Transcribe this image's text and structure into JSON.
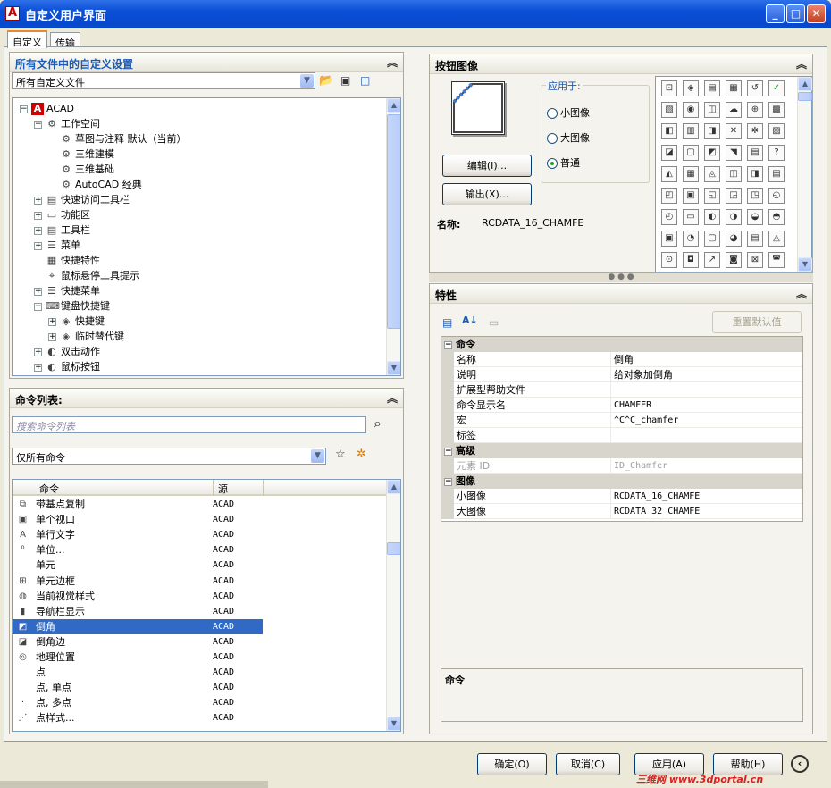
{
  "window": {
    "title": "自定义用户界面",
    "logo_letter": "A"
  },
  "tabs": [
    {
      "label": "自定义"
    },
    {
      "label": "传输"
    }
  ],
  "customizations": {
    "title": "所有文件中的自定义设置",
    "file_select": "所有自定义文件",
    "tree": [
      {
        "label": "ACAD",
        "icon": "acad-logo-icon",
        "expander": "−"
      },
      {
        "label": "工作空间",
        "icon": "gear-icon",
        "expander": "−"
      },
      {
        "label": "草图与注释 默认（当前）",
        "icon": "gear-icon",
        "expander": ""
      },
      {
        "label": "三维建模",
        "icon": "gear-icon",
        "expander": ""
      },
      {
        "label": "三维基础",
        "icon": "gear-icon",
        "expander": ""
      },
      {
        "label": "AutoCAD 经典",
        "icon": "gear-icon",
        "expander": ""
      },
      {
        "label": "快速访问工具栏",
        "icon": "toolbar-icon",
        "expander": "+"
      },
      {
        "label": "功能区",
        "icon": "ribbon-icon",
        "expander": "+"
      },
      {
        "label": "工具栏",
        "icon": "toolbar-icon",
        "expander": "+"
      },
      {
        "label": "菜单",
        "icon": "menu-icon",
        "expander": "+"
      },
      {
        "label": "快捷特性",
        "icon": "properties-icon",
        "expander": ""
      },
      {
        "label": "鼠标悬停工具提示",
        "icon": "tooltip-icon",
        "expander": ""
      },
      {
        "label": "快捷菜单",
        "icon": "menu-icon",
        "expander": "+"
      },
      {
        "label": "键盘快捷键",
        "icon": "keyboard-icon",
        "expander": "−"
      },
      {
        "label": "快捷键",
        "icon": "key-icon",
        "expander": "+"
      },
      {
        "label": "临时替代键",
        "icon": "key-icon",
        "expander": "+"
      },
      {
        "label": "双击动作",
        "icon": "mouse-icon",
        "expander": "+"
      },
      {
        "label": "鼠标按钮",
        "icon": "mouse-icon",
        "expander": "+"
      }
    ]
  },
  "command_list": {
    "title": "命令列表:",
    "search_placeholder": "搜索命令列表",
    "filter_select": "仅所有命令",
    "columns": [
      "命令",
      "源"
    ],
    "rows": [
      {
        "name": "带基点复制",
        "source": "ACAD",
        "icon": "copy-base-icon"
      },
      {
        "name": "单个视口",
        "source": "ACAD",
        "icon": "viewport-icon"
      },
      {
        "name": "单行文字",
        "source": "ACAD",
        "icon": "text-icon"
      },
      {
        "name": "单位...",
        "source": "ACAD",
        "icon": "units-icon"
      },
      {
        "name": "单元",
        "source": "ACAD",
        "icon": ""
      },
      {
        "name": "单元边框",
        "source": "ACAD",
        "icon": "cell-border-icon"
      },
      {
        "name": "当前视觉样式",
        "source": "ACAD",
        "icon": "visual-style-icon"
      },
      {
        "name": "导航栏显示",
        "source": "ACAD",
        "icon": "navbar-icon"
      },
      {
        "name": "倒角",
        "source": "ACAD",
        "icon": "chamfer-icon",
        "selected": true
      },
      {
        "name": "倒角边",
        "source": "ACAD",
        "icon": "chamfer-edge-icon"
      },
      {
        "name": "地理位置",
        "source": "ACAD",
        "icon": "geolocation-icon"
      },
      {
        "name": "点",
        "source": "ACAD",
        "icon": ""
      },
      {
        "name": "点, 单点",
        "source": "ACAD",
        "icon": ""
      },
      {
        "name": "点, 多点",
        "source": "ACAD",
        "icon": "point-icon"
      },
      {
        "name": "点样式...",
        "source": "ACAD",
        "icon": "point-style-icon"
      }
    ]
  },
  "button_image": {
    "title": "按钮图像",
    "apply_to_label": "应用于:",
    "options": [
      {
        "label": "小图像",
        "checked": false
      },
      {
        "label": "大图像",
        "checked": false
      },
      {
        "label": "普通",
        "checked": true
      }
    ],
    "edit_button": "编辑(I)...",
    "export_button": "输出(X)...",
    "name_label": "名称:",
    "name_value": "RCDATA_16_CHAMFE"
  },
  "properties": {
    "title": "特性",
    "reset_button": "重置默认值",
    "categories": [
      {
        "name": "命令",
        "rows": [
          {
            "key": "名称",
            "value": "倒角"
          },
          {
            "key": "说明",
            "value": "给对象加倒角"
          },
          {
            "key": "扩展型帮助文件",
            "value": ""
          },
          {
            "key": "命令显示名",
            "value": "CHAMFER"
          },
          {
            "key": "宏",
            "value": "^C^C_chamfer"
          },
          {
            "key": "标签",
            "value": ""
          }
        ]
      },
      {
        "name": "高级",
        "rows": [
          {
            "key": "元素 ID",
            "value": "ID_Chamfer",
            "disabled": true
          }
        ]
      },
      {
        "name": "图像",
        "rows": [
          {
            "key": "小图像",
            "value": "RCDATA_16_CHAMFE"
          },
          {
            "key": "大图像",
            "value": "RCDATA_32_CHAMFE"
          }
        ]
      }
    ],
    "description_title": "命令"
  },
  "footer": {
    "ok": "确定(O)",
    "cancel": "取消(C)",
    "apply": "应用(A)",
    "help": "帮助(H)",
    "watermark": "三维网 www.3dportal.cn"
  }
}
